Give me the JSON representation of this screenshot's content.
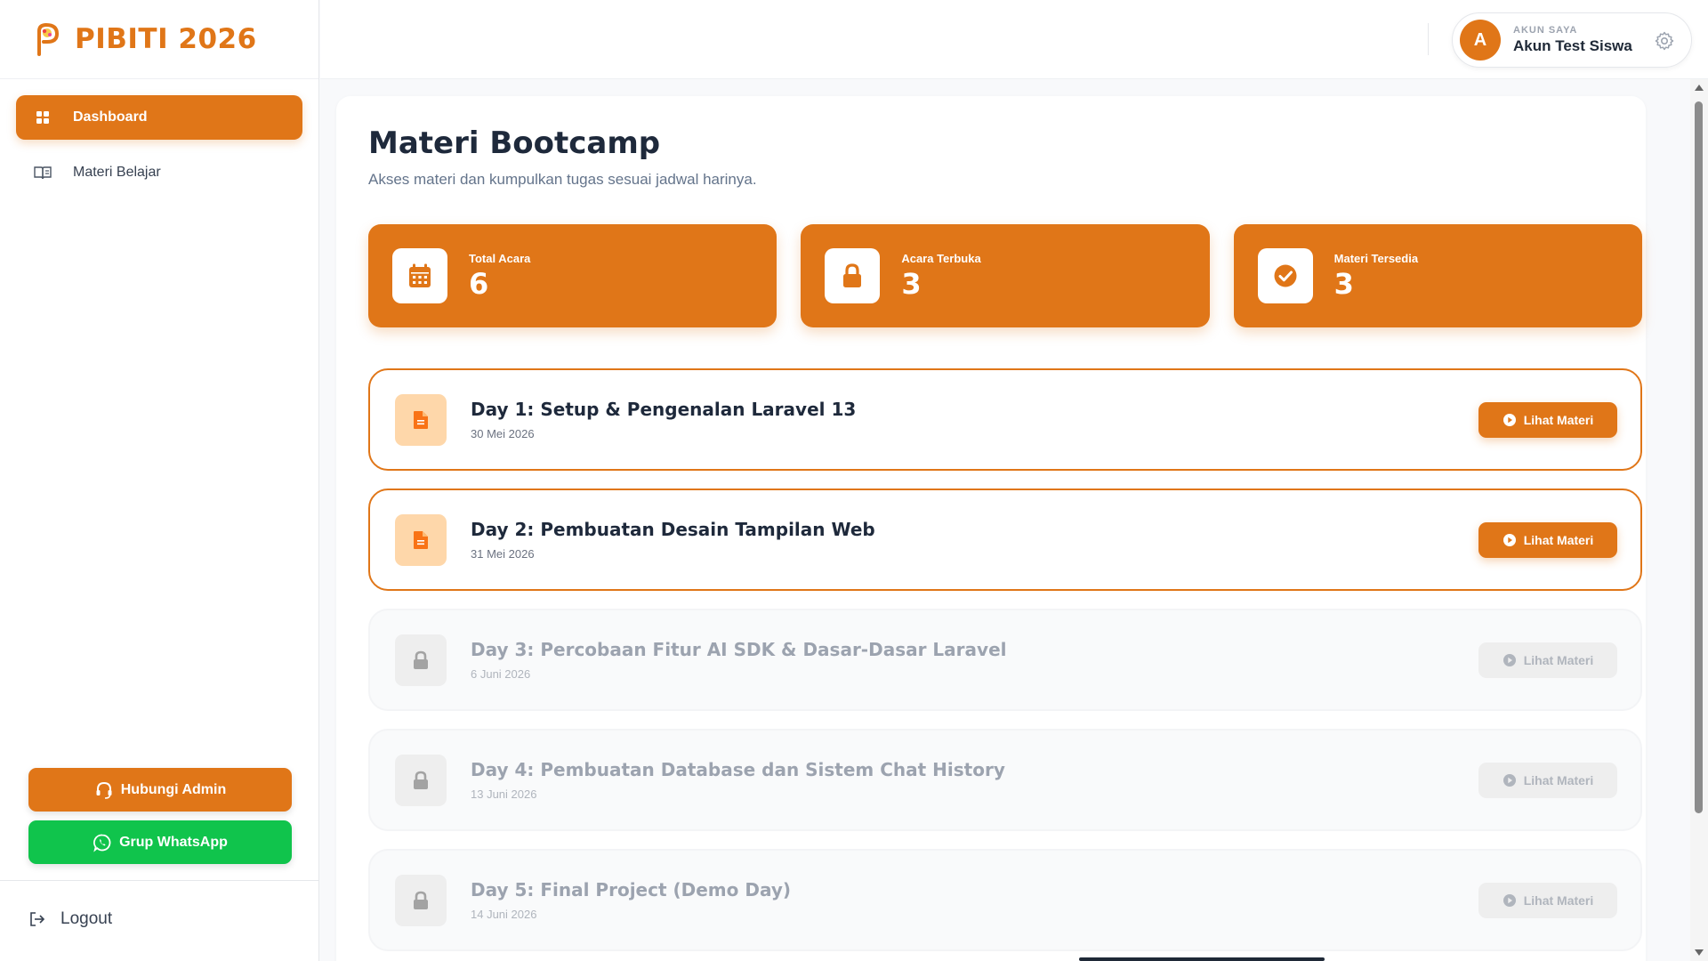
{
  "brand": {
    "name": "PIBITI 2026",
    "accent": "#e07618"
  },
  "sidebar": {
    "items": [
      {
        "label": "Dashboard",
        "icon": "grid-icon",
        "active": true
      },
      {
        "label": "Materi Belajar",
        "icon": "book-icon",
        "active": false
      }
    ],
    "buttons": {
      "admin": {
        "label": "Hubungi Admin",
        "icon": "headset-icon",
        "color": "#e07618"
      },
      "whatsapp": {
        "label": "Grup WhatsApp",
        "icon": "whatsapp-icon",
        "color": "#10c44c"
      }
    },
    "logout": "Logout"
  },
  "account": {
    "initial": "A",
    "label": "AKUN SAYA",
    "name": "Akun Test Siswa"
  },
  "page": {
    "title": "Materi Bootcamp",
    "subtitle": "Akses materi dan kumpulkan tugas sesuai jadwal harinya."
  },
  "stats": [
    {
      "label": "Total Acara",
      "value": "6",
      "icon": "calendar-icon"
    },
    {
      "label": "Acara Terbuka",
      "value": "3",
      "icon": "lock-icon"
    },
    {
      "label": "Materi Tersedia",
      "value": "3",
      "icon": "check-circle-icon"
    }
  ],
  "days": [
    {
      "title": "Day 1: Setup & Pengenalan Laravel 13",
      "date": "30 Mei 2026",
      "status": "open",
      "button": "Lihat Materi"
    },
    {
      "title": "Day 2: Pembuatan Desain Tampilan Web",
      "date": "31 Mei 2026",
      "status": "open",
      "button": "Lihat Materi"
    },
    {
      "title": "Day 3: Percobaan Fitur AI SDK & Dasar-Dasar Laravel",
      "date": "6 Juni 2026",
      "status": "locked",
      "button": "Lihat Materi"
    },
    {
      "title": "Day 4: Pembuatan Database dan Sistem Chat History",
      "date": "13 Juni 2026",
      "status": "locked",
      "button": "Lihat Materi"
    },
    {
      "title": "Day 5: Final Project (Demo Day)",
      "date": "14 Juni 2026",
      "status": "locked",
      "button": "Lihat Materi"
    }
  ]
}
